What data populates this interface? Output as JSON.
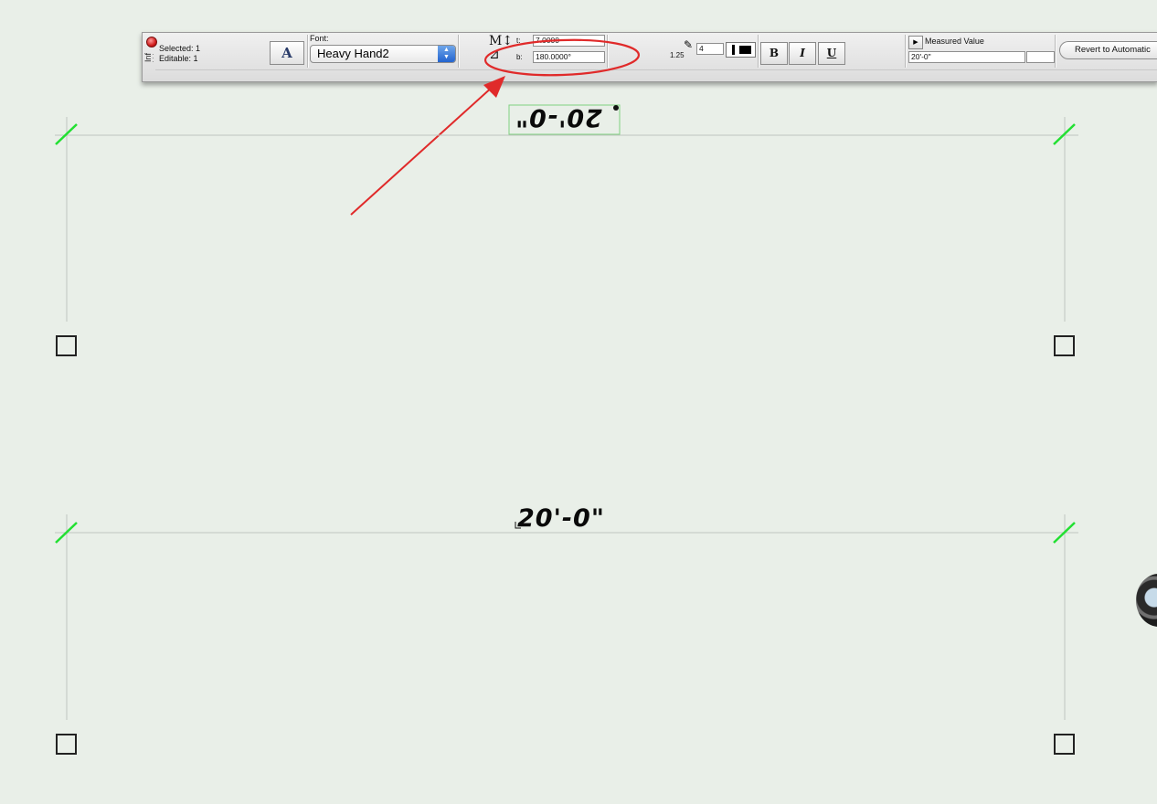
{
  "infobar": {
    "side_label": "Inf",
    "selected": "Selected: 1",
    "editable": "Editable: 1",
    "font_button_glyph": "A",
    "font_label": "Font:",
    "font_value": "Heavy Hand2",
    "t_label": "t:",
    "t_value": "7.0000",
    "b_label": "b:",
    "b_value": "180.0000°",
    "pen_weight": "1.25",
    "thickness_value": "4",
    "bold_label": "B",
    "italic_label": "I",
    "underline_label": "U",
    "measured_label": "Measured Value",
    "measured_value": "20'-0\"",
    "revert_label": "Revert to Automatic"
  },
  "canvas": {
    "dimension_top": "20'-0\"",
    "dimension_bottom": "20'-0\""
  },
  "colors": {
    "tick": "#22e032",
    "annotation": "#e02a2a",
    "background": "#e9efe8"
  },
  "icons": [
    "close-icon",
    "grip-icon",
    "text-size-icon",
    "angle-icon",
    "pen-icon",
    "line-style-icon",
    "disclosure-icon",
    "camera-icon"
  ]
}
